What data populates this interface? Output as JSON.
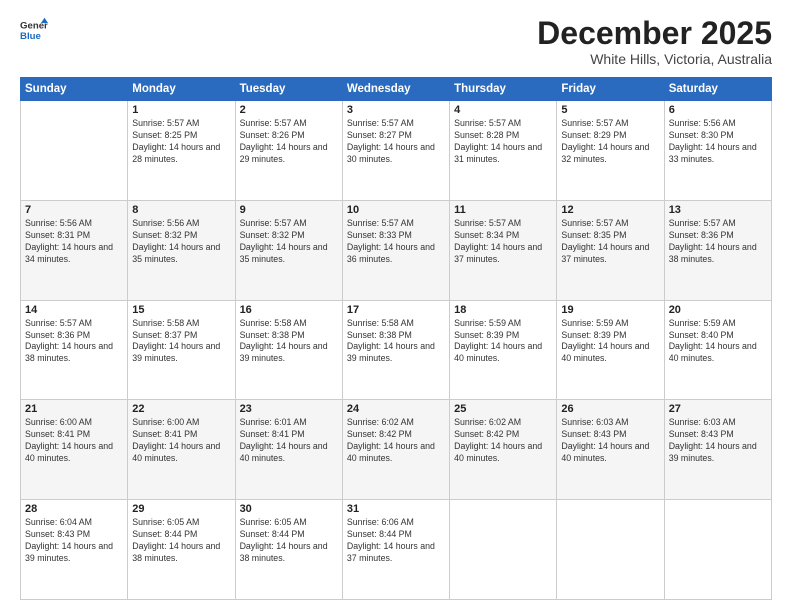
{
  "header": {
    "logo_line1": "General",
    "logo_line2": "Blue",
    "month": "December 2025",
    "location": "White Hills, Victoria, Australia"
  },
  "weekdays": [
    "Sunday",
    "Monday",
    "Tuesday",
    "Wednesday",
    "Thursday",
    "Friday",
    "Saturday"
  ],
  "weeks": [
    [
      {
        "day": "",
        "info": ""
      },
      {
        "day": "1",
        "info": "Sunrise: 5:57 AM\nSunset: 8:25 PM\nDaylight: 14 hours\nand 28 minutes."
      },
      {
        "day": "2",
        "info": "Sunrise: 5:57 AM\nSunset: 8:26 PM\nDaylight: 14 hours\nand 29 minutes."
      },
      {
        "day": "3",
        "info": "Sunrise: 5:57 AM\nSunset: 8:27 PM\nDaylight: 14 hours\nand 30 minutes."
      },
      {
        "day": "4",
        "info": "Sunrise: 5:57 AM\nSunset: 8:28 PM\nDaylight: 14 hours\nand 31 minutes."
      },
      {
        "day": "5",
        "info": "Sunrise: 5:57 AM\nSunset: 8:29 PM\nDaylight: 14 hours\nand 32 minutes."
      },
      {
        "day": "6",
        "info": "Sunrise: 5:56 AM\nSunset: 8:30 PM\nDaylight: 14 hours\nand 33 minutes."
      }
    ],
    [
      {
        "day": "7",
        "info": "Sunrise: 5:56 AM\nSunset: 8:31 PM\nDaylight: 14 hours\nand 34 minutes."
      },
      {
        "day": "8",
        "info": "Sunrise: 5:56 AM\nSunset: 8:32 PM\nDaylight: 14 hours\nand 35 minutes."
      },
      {
        "day": "9",
        "info": "Sunrise: 5:57 AM\nSunset: 8:32 PM\nDaylight: 14 hours\nand 35 minutes."
      },
      {
        "day": "10",
        "info": "Sunrise: 5:57 AM\nSunset: 8:33 PM\nDaylight: 14 hours\nand 36 minutes."
      },
      {
        "day": "11",
        "info": "Sunrise: 5:57 AM\nSunset: 8:34 PM\nDaylight: 14 hours\nand 37 minutes."
      },
      {
        "day": "12",
        "info": "Sunrise: 5:57 AM\nSunset: 8:35 PM\nDaylight: 14 hours\nand 37 minutes."
      },
      {
        "day": "13",
        "info": "Sunrise: 5:57 AM\nSunset: 8:36 PM\nDaylight: 14 hours\nand 38 minutes."
      }
    ],
    [
      {
        "day": "14",
        "info": "Sunrise: 5:57 AM\nSunset: 8:36 PM\nDaylight: 14 hours\nand 38 minutes."
      },
      {
        "day": "15",
        "info": "Sunrise: 5:58 AM\nSunset: 8:37 PM\nDaylight: 14 hours\nand 39 minutes."
      },
      {
        "day": "16",
        "info": "Sunrise: 5:58 AM\nSunset: 8:38 PM\nDaylight: 14 hours\nand 39 minutes."
      },
      {
        "day": "17",
        "info": "Sunrise: 5:58 AM\nSunset: 8:38 PM\nDaylight: 14 hours\nand 39 minutes."
      },
      {
        "day": "18",
        "info": "Sunrise: 5:59 AM\nSunset: 8:39 PM\nDaylight: 14 hours\nand 40 minutes."
      },
      {
        "day": "19",
        "info": "Sunrise: 5:59 AM\nSunset: 8:39 PM\nDaylight: 14 hours\nand 40 minutes."
      },
      {
        "day": "20",
        "info": "Sunrise: 5:59 AM\nSunset: 8:40 PM\nDaylight: 14 hours\nand 40 minutes."
      }
    ],
    [
      {
        "day": "21",
        "info": "Sunrise: 6:00 AM\nSunset: 8:41 PM\nDaylight: 14 hours\nand 40 minutes."
      },
      {
        "day": "22",
        "info": "Sunrise: 6:00 AM\nSunset: 8:41 PM\nDaylight: 14 hours\nand 40 minutes."
      },
      {
        "day": "23",
        "info": "Sunrise: 6:01 AM\nSunset: 8:41 PM\nDaylight: 14 hours\nand 40 minutes."
      },
      {
        "day": "24",
        "info": "Sunrise: 6:02 AM\nSunset: 8:42 PM\nDaylight: 14 hours\nand 40 minutes."
      },
      {
        "day": "25",
        "info": "Sunrise: 6:02 AM\nSunset: 8:42 PM\nDaylight: 14 hours\nand 40 minutes."
      },
      {
        "day": "26",
        "info": "Sunrise: 6:03 AM\nSunset: 8:43 PM\nDaylight: 14 hours\nand 40 minutes."
      },
      {
        "day": "27",
        "info": "Sunrise: 6:03 AM\nSunset: 8:43 PM\nDaylight: 14 hours\nand 39 minutes."
      }
    ],
    [
      {
        "day": "28",
        "info": "Sunrise: 6:04 AM\nSunset: 8:43 PM\nDaylight: 14 hours\nand 39 minutes."
      },
      {
        "day": "29",
        "info": "Sunrise: 6:05 AM\nSunset: 8:44 PM\nDaylight: 14 hours\nand 38 minutes."
      },
      {
        "day": "30",
        "info": "Sunrise: 6:05 AM\nSunset: 8:44 PM\nDaylight: 14 hours\nand 38 minutes."
      },
      {
        "day": "31",
        "info": "Sunrise: 6:06 AM\nSunset: 8:44 PM\nDaylight: 14 hours\nand 37 minutes."
      },
      {
        "day": "",
        "info": ""
      },
      {
        "day": "",
        "info": ""
      },
      {
        "day": "",
        "info": ""
      }
    ]
  ]
}
